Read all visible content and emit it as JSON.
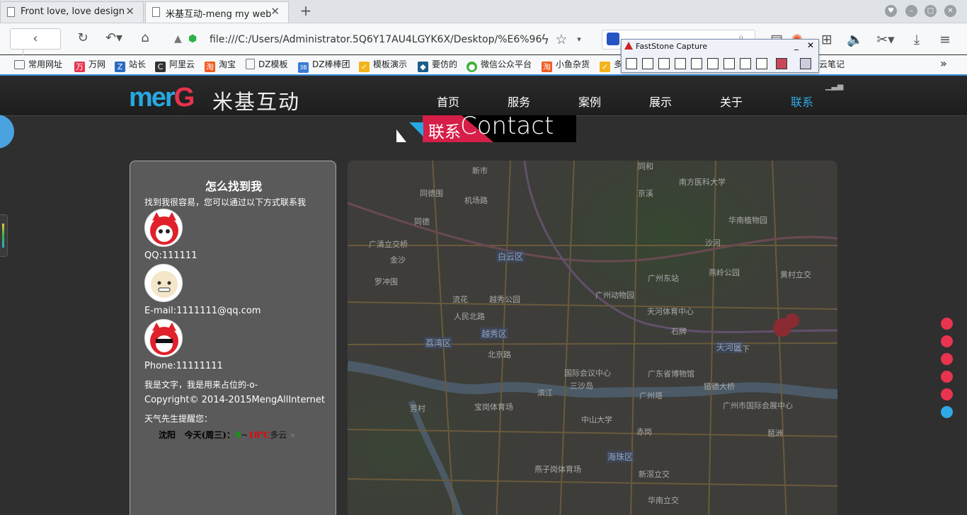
{
  "browser": {
    "tabs": [
      {
        "title": "Front love, love design",
        "close": "✕"
      },
      {
        "title": "米基互动-meng my web...",
        "close": "✕"
      }
    ],
    "new_tab": "+",
    "url": "file:///C:/Users/Administrator.5Q6Y17AU4LGYK6X/Desktop/%E6%96",
    "bookmarks": [
      "常用网址",
      "万网",
      "站长",
      "阿里云",
      "淘宝",
      "DZ模板",
      "DZ棒棒团",
      "模板演示",
      "要仿的",
      "微信公众平台",
      "小鱼杂货",
      "多",
      "云笔记"
    ],
    "more": "»"
  },
  "faststone": {
    "title": "FastStone Capture"
  },
  "site": {
    "logo_en": "merG",
    "logo_cn": "米基互动",
    "nav": [
      "首页",
      "服务",
      "案例",
      "展示",
      "关于",
      "联系"
    ],
    "active_nav": "联系",
    "banner_cn": "联系",
    "banner_en": "Contact",
    "card": {
      "heading": "怎么找到我",
      "intro": "找到我很容易，您可以通过以下方式联系我",
      "qq": "QQ:111111",
      "email": "E-mail:1111111@qq.com",
      "phone": "Phone:11111111",
      "note": "我是文字，我是用来占位的-o-",
      "copyright": "Copyright© 2014-2015MengAllInternet",
      "weather_label": "天气先生提醒您：",
      "weather_city": "沈阳",
      "weather_day": "今天(周三)：",
      "weather_low": "9",
      "weather_sep": "~",
      "weather_high": "18℃",
      "weather_desc": "多云"
    },
    "map_labels": [
      "新市",
      "同和",
      "南方医科大学",
      "同德围",
      "机场路",
      "京溪",
      "华南植物园",
      "同德",
      "广清立交桥",
      "白云区",
      "沙河",
      "金沙",
      "罗冲围",
      "广州东站",
      "燕岭公园",
      "黄村立交",
      "广州动物园",
      "流花",
      "越秀公园",
      "天河体育中心",
      "人民北路",
      "越秀区",
      "石牌",
      "荔湾区",
      "北京路",
      "天河区",
      "国际会议中心",
      "广东省博物馆",
      "棠下",
      "滨江",
      "三沙岛",
      "广州塔",
      "猎德大桥",
      "芳村",
      "宝岗体育场",
      "广州市国际会展中心",
      "中山大学",
      "赤岗",
      "海珠区",
      "新滘立交",
      "燕子岗体育场",
      "琶洲",
      "华南立交"
    ],
    "map_badges": [
      "白云区",
      "越秀区",
      "荔湾区",
      "天河区",
      "海珠区"
    ]
  },
  "colors": {
    "accent_blue": "#2fa9e5",
    "accent_red": "#e8344e"
  }
}
